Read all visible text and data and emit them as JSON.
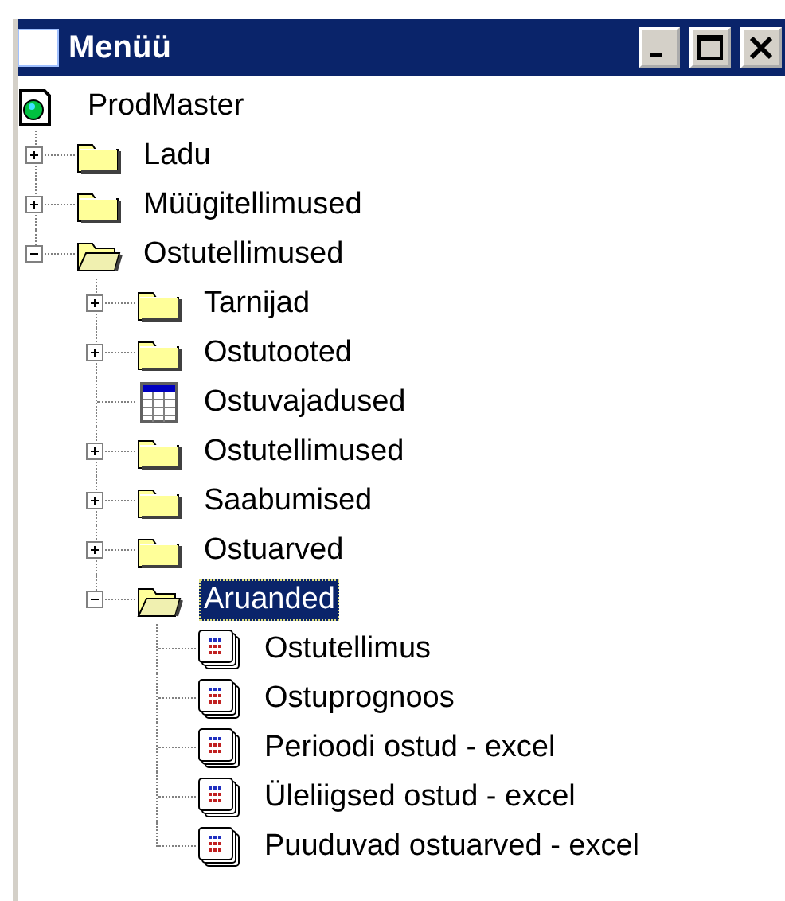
{
  "window": {
    "title": "Menüü"
  },
  "tree": {
    "label": "ProdMaster",
    "kind": "root",
    "selected": false,
    "children": [
      {
        "label": "Ladu",
        "kind": "folder",
        "expanded": false,
        "selected": false
      },
      {
        "label": "Müügitellimused",
        "kind": "folder",
        "expanded": false,
        "selected": false
      },
      {
        "label": "Ostutellimused",
        "kind": "folder",
        "expanded": true,
        "selected": false,
        "children": [
          {
            "label": "Tarnijad",
            "kind": "folder",
            "expanded": false,
            "selected": false
          },
          {
            "label": "Ostutooted",
            "kind": "folder",
            "expanded": false,
            "selected": false
          },
          {
            "label": "Ostuvajadused",
            "kind": "table",
            "selected": false
          },
          {
            "label": "Ostutellimused",
            "kind": "folder",
            "expanded": false,
            "selected": false
          },
          {
            "label": "Saabumised",
            "kind": "folder",
            "expanded": false,
            "selected": false
          },
          {
            "label": "Ostuarved",
            "kind": "folder",
            "expanded": false,
            "selected": false
          },
          {
            "label": "Aruanded",
            "kind": "folder",
            "expanded": true,
            "selected": true,
            "children": [
              {
                "label": "Ostutellimus",
                "kind": "report",
                "selected": false
              },
              {
                "label": "Ostuprognoos",
                "kind": "report",
                "selected": false
              },
              {
                "label": "Perioodi ostud - excel",
                "kind": "report",
                "selected": false
              },
              {
                "label": "Üleliigsed ostud - excel",
                "kind": "report",
                "selected": false
              },
              {
                "label": "Puuduvad ostuarved - excel",
                "kind": "report",
                "selected": false
              }
            ]
          }
        ]
      }
    ]
  }
}
